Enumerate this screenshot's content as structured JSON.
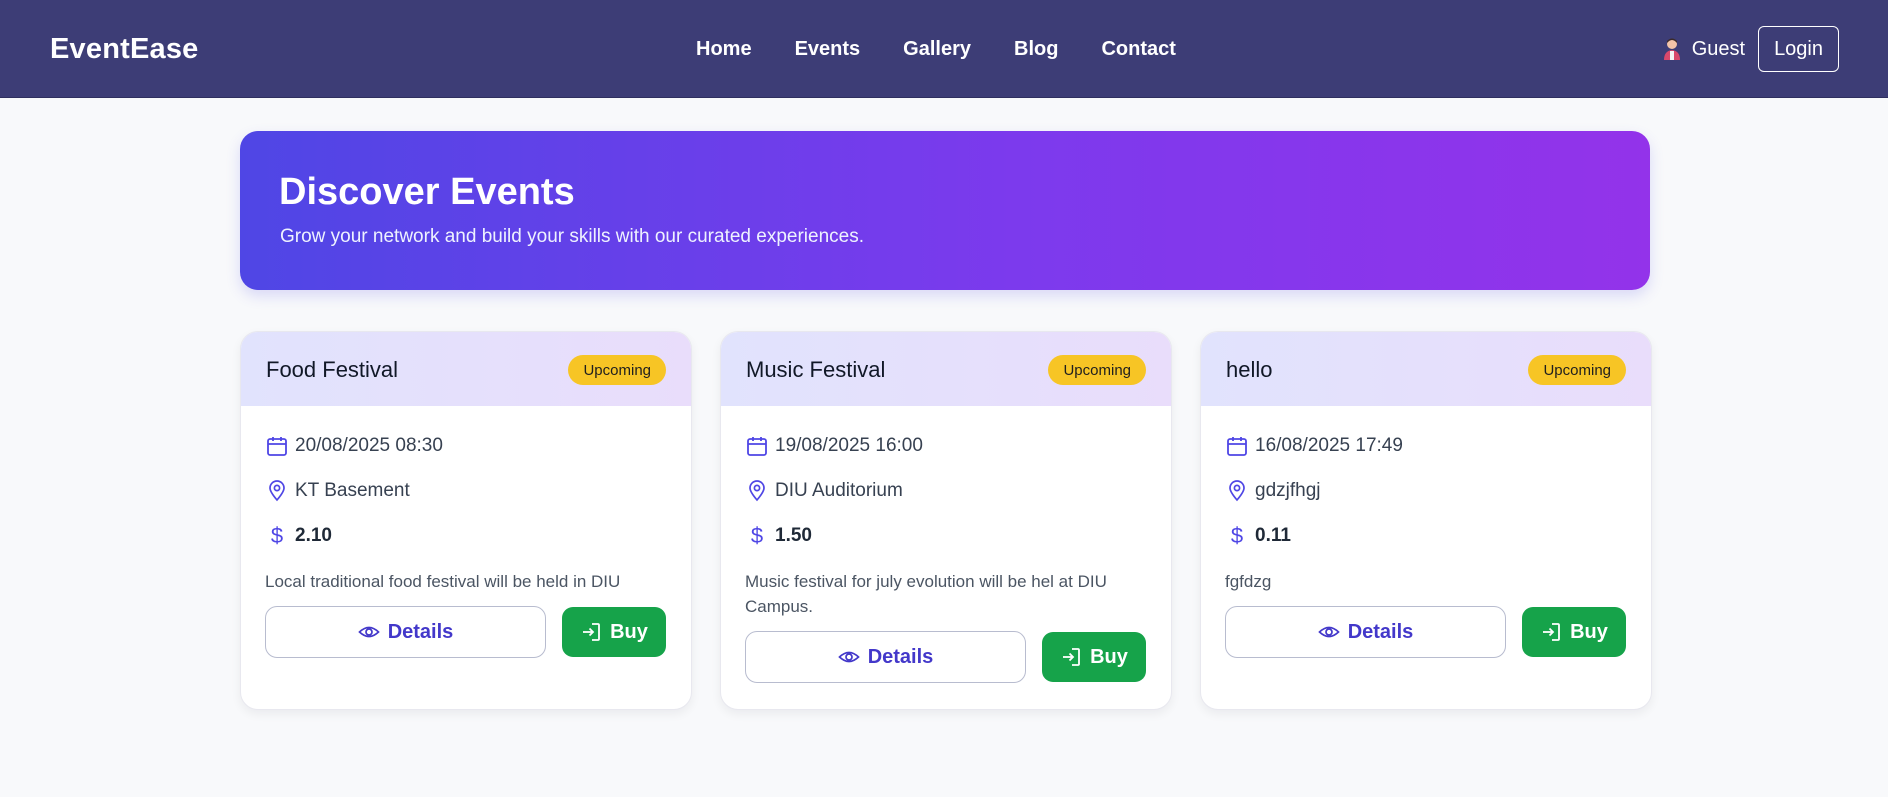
{
  "header": {
    "brand": "EventEase",
    "nav": [
      "Home",
      "Events",
      "Gallery",
      "Blog",
      "Contact"
    ],
    "user_label": "Guest",
    "login_label": "Login"
  },
  "hero": {
    "title": "Discover Events",
    "subtitle": "Grow your network and build your skills with our curated experiences."
  },
  "events": [
    {
      "title": "Food Festival",
      "status": "Upcoming",
      "datetime": "20/08/2025 08:30",
      "location": "KT Basement",
      "price": "2.10",
      "description": "Local traditional food festival will be held in DIU",
      "details_label": "Details",
      "buy_label": "Buy"
    },
    {
      "title": "Music Festival",
      "status": "Upcoming",
      "datetime": "19/08/2025 16:00",
      "location": "DIU Auditorium",
      "price": "1.50",
      "description": "Music festival for july evolution will be hel at DIU Campus.",
      "details_label": "Details",
      "buy_label": "Buy"
    },
    {
      "title": "hello",
      "status": "Upcoming",
      "datetime": "16/08/2025 17:49",
      "location": "gdzjfhgj",
      "price": "0.11",
      "description": "fgfdzg",
      "details_label": "Details",
      "buy_label": "Buy"
    }
  ],
  "currency_symbol": "$",
  "colors": {
    "navbar": "#3d3d76",
    "hero_start": "#4f46e5",
    "hero_end": "#9333ea",
    "badge": "#f7c525",
    "buy_button": "#16a34a",
    "accent": "#4338ca"
  }
}
